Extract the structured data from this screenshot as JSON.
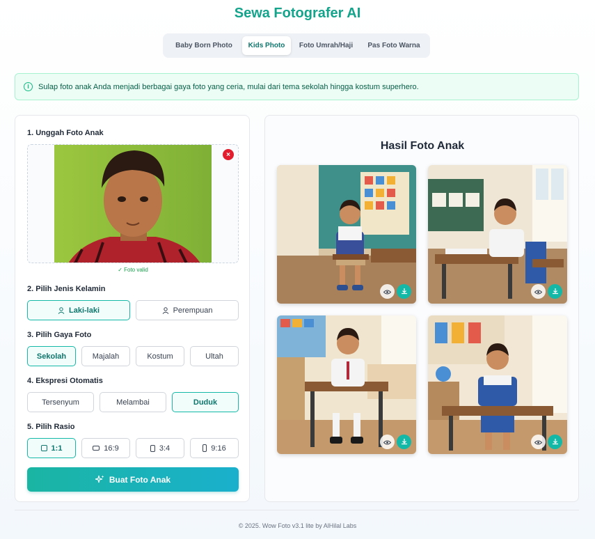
{
  "app": {
    "title": "Sewa Fotografer AI"
  },
  "tabs": [
    {
      "label": "Baby Born Photo",
      "active": false
    },
    {
      "label": "Kids Photo",
      "active": true
    },
    {
      "label": "Foto Umrah/Haji",
      "active": false
    },
    {
      "label": "Pas Foto Warna",
      "active": false
    }
  ],
  "info": {
    "icon": "info-icon",
    "text": "Sulap foto anak Anda menjadi berbagai gaya foto yang ceria, mulai dari tema sekolah hingga kostum superhero."
  },
  "upload": {
    "label": "1. Unggah Foto Anak",
    "status": "✓ Foto valid",
    "remove_icon": "close-icon"
  },
  "gender": {
    "label": "2. Pilih Jenis Kelamin",
    "options": [
      {
        "label": "Laki-laki",
        "icon": "user-icon",
        "selected": true
      },
      {
        "label": "Perempuan",
        "icon": "user-icon",
        "selected": false
      }
    ]
  },
  "style": {
    "label": "3. Pilih Gaya Foto",
    "options": [
      {
        "label": "Sekolah",
        "selected": true
      },
      {
        "label": "Majalah",
        "selected": false
      },
      {
        "label": "Kostum",
        "selected": false
      },
      {
        "label": "Ultah",
        "selected": false
      }
    ]
  },
  "expression": {
    "label": "4. Ekspresi Otomatis",
    "options": [
      {
        "label": "Tersenyum",
        "selected": false
      },
      {
        "label": "Melambai",
        "selected": false
      },
      {
        "label": "Duduk",
        "selected": true
      }
    ]
  },
  "ratio": {
    "label": "5. Pilih Rasio",
    "options": [
      {
        "label": "1:1",
        "icon": "square-icon",
        "selected": true
      },
      {
        "label": "16:9",
        "icon": "landscape-icon",
        "selected": false
      },
      {
        "label": "3:4",
        "icon": "portrait-icon",
        "selected": false
      },
      {
        "label": "9:16",
        "icon": "tall-portrait-icon",
        "selected": false
      }
    ]
  },
  "generate": {
    "label": "Buat Foto Anak",
    "icon": "sparkle-icon"
  },
  "results": {
    "title": "Hasil Foto Anak",
    "actions": {
      "view_icon": "eye-icon",
      "download_icon": "download-icon"
    }
  },
  "footer": {
    "text": "© 2025. Wow Foto v3.1 lite by AlHilal Labs"
  },
  "colors": {
    "accent": "#14a38b",
    "button_gradient_start": "#1bb5a3",
    "button_gradient_end": "#1ab0cd",
    "error": "#e11d2e"
  }
}
